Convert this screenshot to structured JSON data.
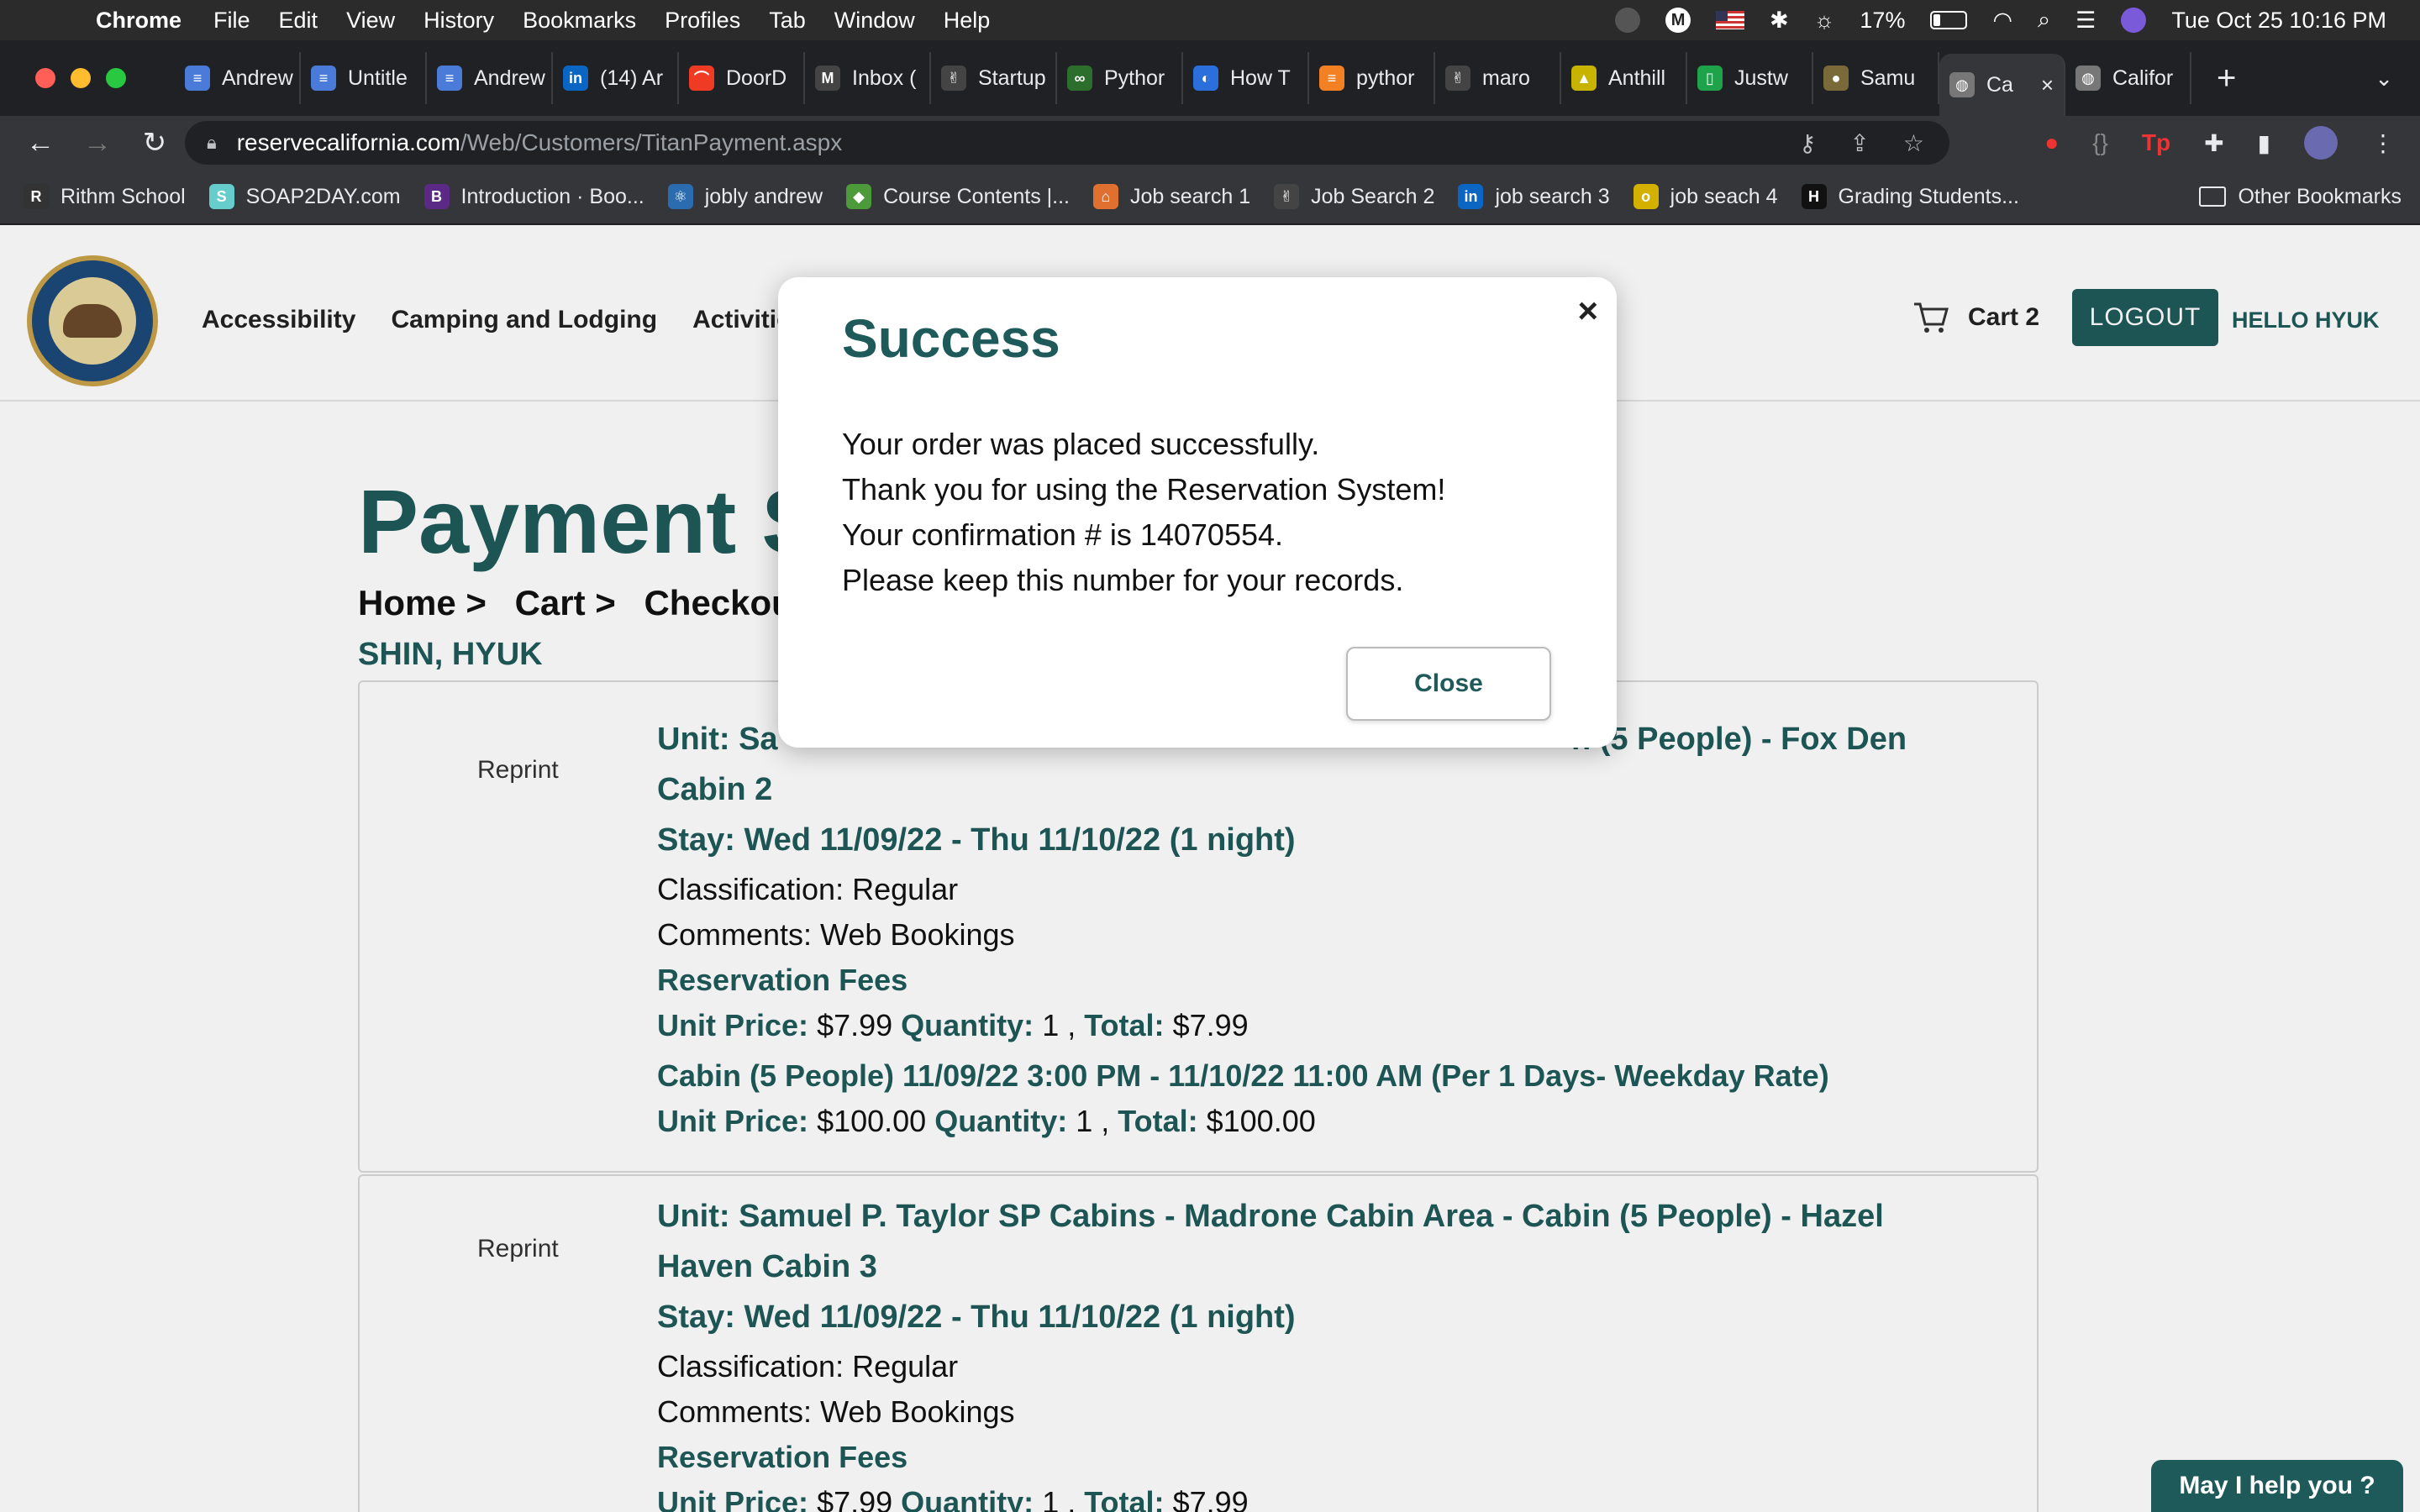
{
  "menubar": {
    "app": "Chrome",
    "items": [
      "File",
      "Edit",
      "View",
      "History",
      "Bookmarks",
      "Profiles",
      "Tab",
      "Window",
      "Help"
    ],
    "battery": "17%",
    "datetime": "Tue Oct 25  10:16 PM"
  },
  "tabs": [
    {
      "label": "Andrew",
      "color": "#4a7bd8",
      "glyph": "≡"
    },
    {
      "label": "Untitle",
      "color": "#4a7bd8",
      "glyph": "≡"
    },
    {
      "label": "Andrew",
      "color": "#4a7bd8",
      "glyph": "≡"
    },
    {
      "label": "(14) Ar",
      "color": "#0a66c2",
      "glyph": "in"
    },
    {
      "label": "DoorD",
      "color": "#ef3b24",
      "glyph": "⌒"
    },
    {
      "label": "Inbox (",
      "color": "#444",
      "glyph": "M"
    },
    {
      "label": "Startup",
      "color": "#444",
      "glyph": "✌"
    },
    {
      "label": "Pythor",
      "color": "#2c6e2c",
      "glyph": "∞"
    },
    {
      "label": "How T",
      "color": "#2a6fdb",
      "glyph": "◐"
    },
    {
      "label": "pythor",
      "color": "#f48024",
      "glyph": "≡"
    },
    {
      "label": "maro",
      "color": "#444",
      "glyph": "✌"
    },
    {
      "label": "Anthill",
      "color": "#c8b400",
      "glyph": "▲"
    },
    {
      "label": "Justw",
      "color": "#1ea34a",
      "glyph": "▯"
    },
    {
      "label": "Samu",
      "color": "#7a6a3a",
      "glyph": "●"
    },
    {
      "label": "Ca",
      "color": "#777",
      "glyph": "◍",
      "active": true
    },
    {
      "label": "Califor",
      "color": "#777",
      "glyph": "◍"
    }
  ],
  "toolbar": {
    "url_host": "reservecalifornia.com",
    "url_path": "/Web/Customers/TitanPayment.aspx"
  },
  "bookmarks": [
    {
      "label": "Rithm School",
      "color": "#333",
      "glyph": "R"
    },
    {
      "label": "SOAP2DAY.com",
      "color": "#6cc",
      "glyph": "S"
    },
    {
      "label": "Introduction · Boo...",
      "color": "#5b2a86",
      "glyph": "B"
    },
    {
      "label": "jobly andrew",
      "color": "#2b6cb0",
      "glyph": "⚛"
    },
    {
      "label": "Course Contents |...",
      "color": "#4c9a3a",
      "glyph": "◆"
    },
    {
      "label": "Job search 1",
      "color": "#e07030",
      "glyph": "⌂"
    },
    {
      "label": "Job Search 2",
      "color": "#444",
      "glyph": "✌"
    },
    {
      "label": "job search 3",
      "color": "#0a66c2",
      "glyph": "in"
    },
    {
      "label": "job seach 4",
      "color": "#d4b000",
      "glyph": "o"
    },
    {
      "label": "Grading Students...",
      "color": "#111",
      "glyph": "H"
    }
  ],
  "other_bookmarks": "Other Bookmarks",
  "site": {
    "nav": [
      "Accessibility",
      "Camping and Lodging",
      "Activities"
    ],
    "cart_label": "Cart 2",
    "logout": "LOGOUT",
    "hello": "HELLO HYUK",
    "page_title": "Payment Su",
    "breadcrumb": [
      "Home >",
      "Cart >",
      "Checkou"
    ],
    "customer": "SHIN, HYUK",
    "help": "May I help you ?"
  },
  "reservations": [
    {
      "reprint": "Reprint",
      "unit": "Unit: Sa",
      "unit_tail": "n (5 People) - Fox Den",
      "unit_line2": "Cabin 2",
      "stay": "Stay: Wed 11/09/22 - Thu 11/10/22 (1 night)",
      "classification": "Classification: Regular",
      "comments": "Comments: Web Bookings",
      "fees_heading": "Reservation Fees",
      "fee": {
        "unit_price": "$7.99",
        "quantity": "1",
        "total": "$7.99"
      },
      "cabin_line": "Cabin (5 People) 11/09/22 3:00 PM - 11/10/22 11:00 AM (Per 1 Days- Weekday Rate)",
      "cabin_fee": {
        "unit_price": "$100.00",
        "quantity": "1",
        "total": "$100.00"
      }
    },
    {
      "reprint": "Reprint",
      "unit": "Unit: Samuel P. Taylor SP Cabins - Madrone Cabin Area - Cabin (5 People) - Hazel",
      "unit_line2": "Haven Cabin 3",
      "stay": "Stay: Wed 11/09/22 - Thu 11/10/22 (1 night)",
      "classification": "Classification: Regular",
      "comments": "Comments: Web Bookings",
      "fees_heading": "Reservation Fees",
      "fee": {
        "unit_price": "$7.99",
        "quantity": "1",
        "total": "$7.99"
      }
    }
  ],
  "labels": {
    "unit_price": "Unit Price:",
    "quantity": "Quantity:",
    "total": "Total:"
  },
  "modal": {
    "title": "Success",
    "lines": [
      "Your order was placed successfully.",
      "Thank you for using the Reservation System!",
      "Your confirmation # is 14070554.",
      "Please keep this number for your records."
    ],
    "close_label": "Close",
    "close_x": "×"
  }
}
